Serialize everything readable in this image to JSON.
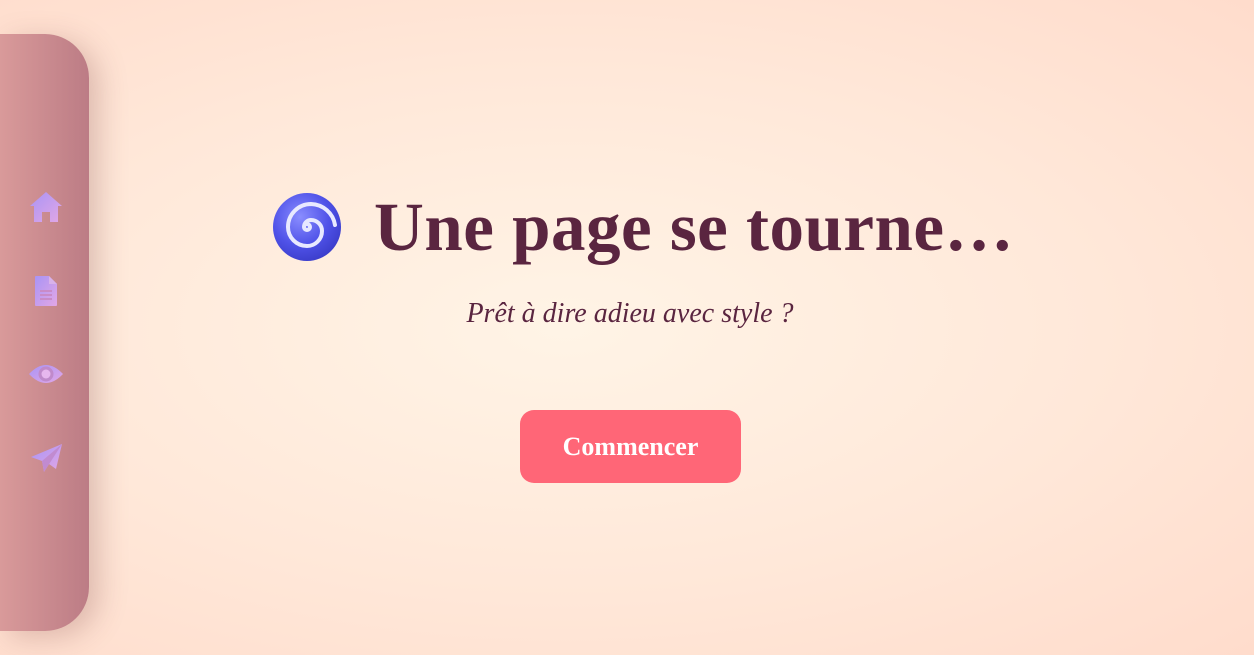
{
  "sidebar": {
    "items": [
      {
        "icon": "home-icon"
      },
      {
        "icon": "document-icon"
      },
      {
        "icon": "eye-icon"
      },
      {
        "icon": "send-icon"
      }
    ]
  },
  "hero": {
    "icon": "spiral-icon",
    "title": "Une page se tourne…",
    "subtitle": "Prêt à dire adieu avec style ?",
    "button_label": "Commencer"
  },
  "colors": {
    "title": "#5a2540",
    "button": "#ff6677",
    "sidebar_start": "#d99a9a",
    "sidebar_end": "#bc7c85",
    "icon_start": "#b39bf2",
    "icon_end": "#e0a6e8"
  }
}
